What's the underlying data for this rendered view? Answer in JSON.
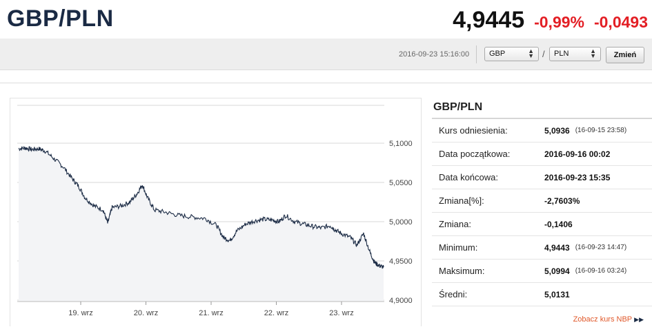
{
  "header": {
    "pair": "GBP/PLN",
    "price": "4,9445",
    "change_pct": "-0,99%",
    "change_abs": "-0,0493"
  },
  "toolbar": {
    "timestamp": "2016-09-23 15:16:00",
    "from_currency": "GBP",
    "separator": "/",
    "to_currency": "PLN",
    "submit_label": "Zmień"
  },
  "colors": {
    "accent_negative": "#e31e24",
    "title_navy": "#1a2a44",
    "series_line": "#1a2a44",
    "link_orange": "#e0582a"
  },
  "chart_data": {
    "type": "line",
    "x_tick_labels": [
      "19. wrz",
      "20. wrz",
      "21. wrz",
      "22. wrz",
      "23. wrz"
    ],
    "y_tick_labels": [
      "5,1000",
      "5,0500",
      "5,0000",
      "4,9500",
      "4,9000"
    ],
    "y_ticks": [
      5.1,
      5.05,
      5.0,
      4.95,
      4.9
    ],
    "ylim": [
      4.9,
      5.15
    ],
    "xlim": [
      0,
      7.6
    ],
    "grid": true,
    "series": [
      {
        "points": [
          [
            0.0,
            5.093
          ],
          [
            0.15,
            5.094
          ],
          [
            0.3,
            5.092
          ],
          [
            0.45,
            5.093
          ],
          [
            0.6,
            5.09
          ],
          [
            0.8,
            5.08
          ],
          [
            1.0,
            5.07
          ],
          [
            1.2,
            5.055
          ],
          [
            1.35,
            5.045
          ],
          [
            1.5,
            5.03
          ],
          [
            1.7,
            5.02
          ],
          [
            1.9,
            5.015
          ],
          [
            2.0,
            4.998
          ],
          [
            2.1,
            5.018
          ],
          [
            2.3,
            5.02
          ],
          [
            2.5,
            5.025
          ],
          [
            2.65,
            5.035
          ],
          [
            2.78,
            5.047
          ],
          [
            2.9,
            5.03
          ],
          [
            3.05,
            5.015
          ],
          [
            3.3,
            5.012
          ],
          [
            3.6,
            5.008
          ],
          [
            3.9,
            5.006
          ],
          [
            4.2,
            5.004
          ],
          [
            4.45,
            4.995
          ],
          [
            4.6,
            4.98
          ],
          [
            4.75,
            4.976
          ],
          [
            4.9,
            4.988
          ],
          [
            5.1,
            4.997
          ],
          [
            5.3,
            5.001
          ],
          [
            5.5,
            5.003
          ],
          [
            5.7,
            5.002
          ],
          [
            5.85,
            5.0
          ],
          [
            6.0,
            5.008
          ],
          [
            6.2,
            5.0
          ],
          [
            6.4,
            4.997
          ],
          [
            6.6,
            4.994
          ],
          [
            6.8,
            4.992
          ],
          [
            7.0,
            4.995
          ],
          [
            7.1,
            4.99
          ],
          [
            7.25,
            4.985
          ],
          [
            7.45,
            4.98
          ],
          [
            7.6,
            4.97
          ],
          [
            7.75,
            4.985
          ],
          [
            7.9,
            4.96
          ],
          [
            8.0,
            4.948
          ],
          [
            8.1,
            4.944
          ],
          [
            8.2,
            4.942
          ]
        ]
      }
    ]
  },
  "info": {
    "title": "GBP/PLN",
    "rows": [
      {
        "label": "Kurs odniesienia:",
        "value": "5,0936",
        "date": "(16-09-15 23:58)"
      },
      {
        "label": "Data początkowa:",
        "value": "2016-09-16 00:02",
        "date": ""
      },
      {
        "label": "Data końcowa:",
        "value": "2016-09-23 15:35",
        "date": ""
      },
      {
        "label": "Zmiana[%]:",
        "value": "-2,7603%",
        "date": ""
      },
      {
        "label": "Zmiana:",
        "value": "-0,1406",
        "date": ""
      },
      {
        "label": "Minimum:",
        "value": "4,9443",
        "date": "(16-09-23 14:47)"
      },
      {
        "label": "Maksimum:",
        "value": "5,0994",
        "date": "(16-09-16 03:24)"
      },
      {
        "label": "Średni:",
        "value": "5,0131",
        "date": ""
      }
    ]
  },
  "footer_link": {
    "text": "Zobacz kurs NBP",
    "icon": "double-chevron-right-icon"
  }
}
